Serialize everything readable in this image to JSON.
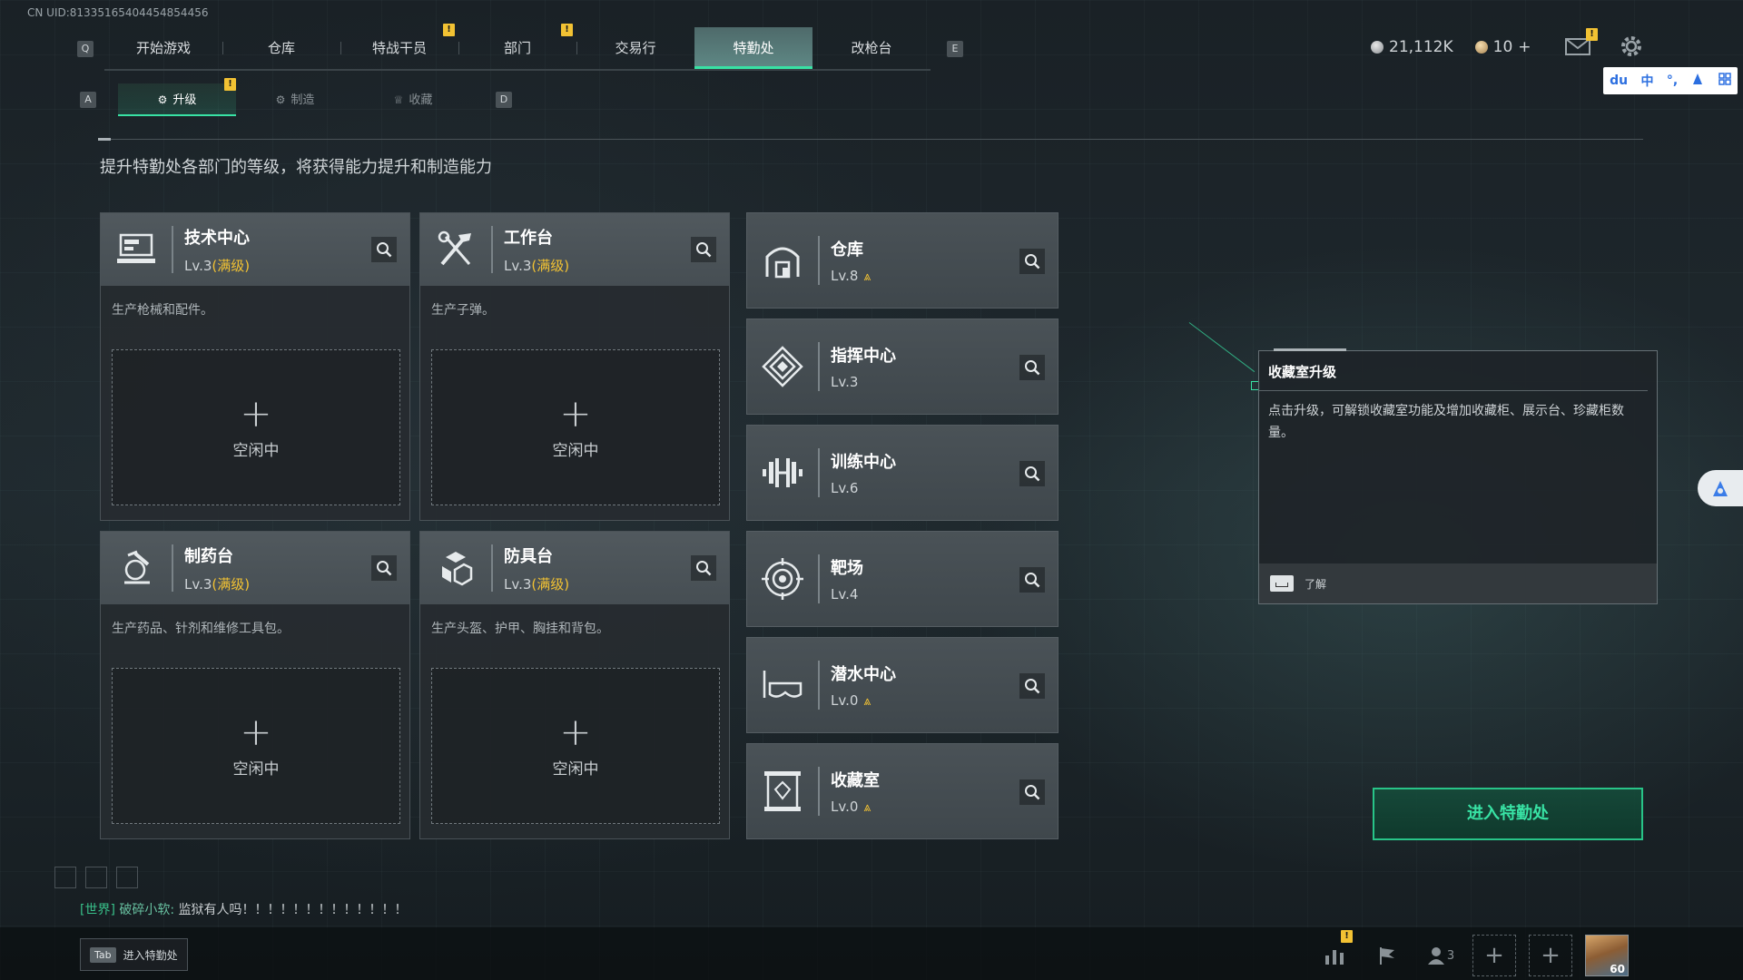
{
  "uid": "CN UID:81335165404454854456",
  "nav": {
    "key_left": "Q",
    "key_right": "E",
    "tabs": [
      {
        "label": "开始游戏",
        "active": false,
        "badge": false
      },
      {
        "label": "仓库",
        "active": false,
        "badge": false
      },
      {
        "label": "特战干员",
        "active": false,
        "badge": true
      },
      {
        "label": "部门",
        "active": false,
        "badge": true
      },
      {
        "label": "交易行",
        "active": false,
        "badge": false
      },
      {
        "label": "特勤处",
        "active": true,
        "badge": false
      },
      {
        "label": "改枪台",
        "active": false,
        "badge": false
      }
    ]
  },
  "badge_text": "!",
  "currency": {
    "silver": "21,112K",
    "gold": "10",
    "gold_add": "+"
  },
  "ime": {
    "brand": "du",
    "lang": "中",
    "punct": "°,"
  },
  "subnav": {
    "key_left": "A",
    "key_right": "D",
    "tabs": [
      {
        "label": "升级",
        "active": true,
        "icon": "upgrade-icon"
      },
      {
        "label": "制造",
        "active": false,
        "icon": "craft-icon"
      },
      {
        "label": "收藏",
        "active": false,
        "icon": "collection-icon"
      }
    ]
  },
  "subtitle": "提升特勤处各部门的等级，将获得能力提升和制造能力",
  "production_cards": [
    {
      "title": "技术中心",
      "level": "Lv.3",
      "max": "(满级)",
      "desc": "生产枪械和配件。",
      "slot": "空闲中",
      "icon": "tech-center-icon"
    },
    {
      "title": "工作台",
      "level": "Lv.3",
      "max": "(满级)",
      "desc": "生产子弹。",
      "slot": "空闲中",
      "icon": "workbench-icon"
    },
    {
      "title": "制药台",
      "level": "Lv.3",
      "max": "(满级)",
      "desc": "生产药品、针剂和维修工具包。",
      "slot": "空闲中",
      "icon": "pharmacy-icon"
    },
    {
      "title": "防具台",
      "level": "Lv.3",
      "max": "(满级)",
      "desc": "生产头盔、护甲、胸挂和背包。",
      "slot": "空闲中",
      "icon": "armor-bench-icon"
    }
  ],
  "slot_plus": "+",
  "facilities": [
    {
      "title": "仓库",
      "level": "Lv.8",
      "upgradable": true,
      "icon": "warehouse-icon"
    },
    {
      "title": "指挥中心",
      "level": "Lv.3",
      "upgradable": false,
      "icon": "command-center-icon"
    },
    {
      "title": "训练中心",
      "level": "Lv.6",
      "upgradable": false,
      "icon": "training-center-icon"
    },
    {
      "title": "靶场",
      "level": "Lv.4",
      "upgradable": false,
      "icon": "shooting-range-icon"
    },
    {
      "title": "潜水中心",
      "level": "Lv.0",
      "upgradable": true,
      "icon": "diving-center-icon"
    },
    {
      "title": "收藏室",
      "level": "Lv.0",
      "upgradable": true,
      "icon": "collection-room-icon"
    }
  ],
  "upgrade_mark": "⩓",
  "tooltip": {
    "title": "收藏室升级",
    "desc": "点击升级，可解锁收藏室功能及增加收藏柜、展示台、珍藏柜数量。",
    "action": "了解"
  },
  "enter_button": "进入特勤处",
  "chat": {
    "channel": "[世界]",
    "user": "破碎小软:",
    "message": "监狱有人吗！！！！！！！！！！！！！"
  },
  "tab_hint": {
    "key": "Tab",
    "label": "进入特勤处"
  },
  "bottom": {
    "friends_count": "3",
    "avatar_level": "60"
  }
}
